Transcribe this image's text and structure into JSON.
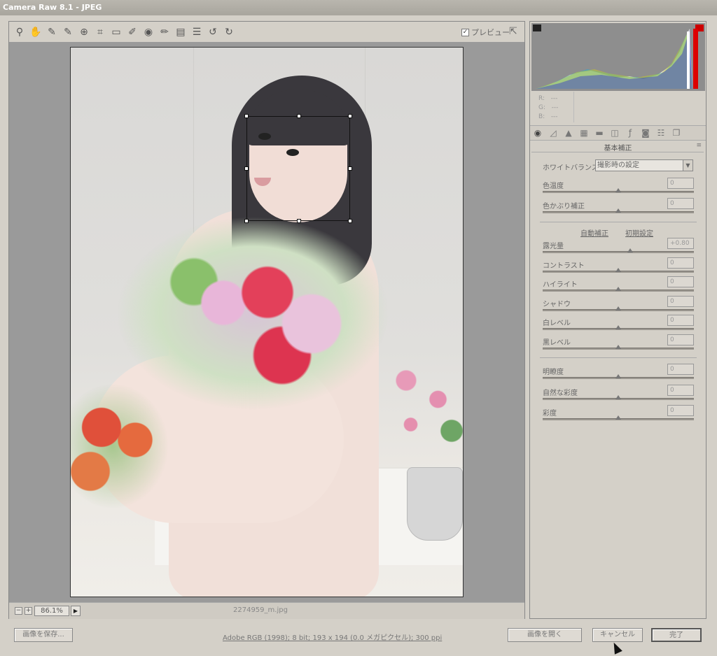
{
  "window": {
    "title": "Camera Raw 8.1  -  JPEG"
  },
  "toolbar": {
    "tools": [
      {
        "name": "zoom-icon",
        "glyph": "⚲"
      },
      {
        "name": "hand-icon",
        "glyph": "✋"
      },
      {
        "name": "white-balance-eyedropper-icon",
        "glyph": "✎"
      },
      {
        "name": "color-sampler-icon",
        "glyph": "✎"
      },
      {
        "name": "targeted-adjustment-icon",
        "glyph": "⊕"
      },
      {
        "name": "crop-icon",
        "glyph": "⌗"
      },
      {
        "name": "straighten-icon",
        "glyph": "▭"
      },
      {
        "name": "spot-removal-icon",
        "glyph": "✐"
      },
      {
        "name": "red-eye-icon",
        "glyph": "◉"
      },
      {
        "name": "adjustment-brush-icon",
        "glyph": "✏"
      },
      {
        "name": "graduated-filter-icon",
        "glyph": "▤"
      },
      {
        "name": "preferences-icon",
        "glyph": "☰"
      },
      {
        "name": "rotate-ccw-icon",
        "glyph": "↺"
      },
      {
        "name": "rotate-cw-icon",
        "glyph": "↻"
      }
    ],
    "preview_label": "プレビュー",
    "preview_checked": true
  },
  "status": {
    "zoom": "86.1%",
    "filename": "2274959_m.jpg"
  },
  "histogram": {
    "r": "---",
    "g": "---",
    "b": "---",
    "labels": [
      "R:",
      "G:",
      "B:"
    ]
  },
  "panel": {
    "title": "基本補正",
    "white_balance_label": "ホワイトバランス：",
    "white_balance_value": "撮影時の設定",
    "sliders_top": [
      {
        "label": "色温度",
        "value": "0",
        "pos": 0.5
      },
      {
        "label": "色かぶり補正",
        "value": "0",
        "pos": 0.5
      }
    ],
    "auto_label": "自動補正",
    "default_label": "初期設定",
    "sliders_mid": [
      {
        "label": "露光量",
        "value": "+0.80",
        "pos": 0.58
      },
      {
        "label": "コントラスト",
        "value": "0",
        "pos": 0.5
      },
      {
        "label": "ハイライト",
        "value": "0",
        "pos": 0.5
      },
      {
        "label": "シャドウ",
        "value": "0",
        "pos": 0.5
      },
      {
        "label": "白レベル",
        "value": "0",
        "pos": 0.5
      },
      {
        "label": "黒レベル",
        "value": "0",
        "pos": 0.5
      }
    ],
    "sliders_bottom": [
      {
        "label": "明瞭度",
        "value": "0",
        "pos": 0.5
      },
      {
        "label": "自然な彩度",
        "value": "0",
        "pos": 0.5
      },
      {
        "label": "彩度",
        "value": "0",
        "pos": 0.5
      }
    ]
  },
  "bottom": {
    "save_label": "画像を保存...",
    "info": "Adobe RGB (1998); 8 bit; 193 x 194 (0.0 メガピクセル); 300 ppi",
    "open_label": "画像を開く",
    "cancel_label": "キャンセル",
    "done_label": "完了"
  }
}
